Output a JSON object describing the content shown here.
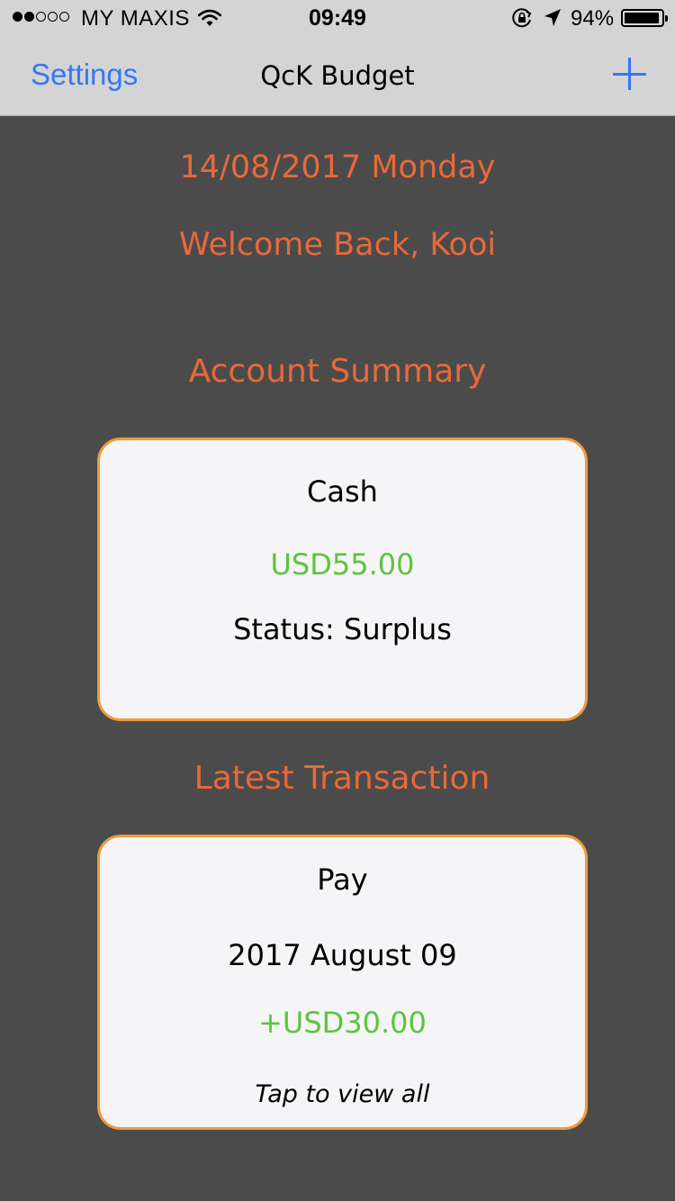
{
  "status_bar": {
    "carrier": "MY MAXIS",
    "time": "09:49",
    "battery_percent_label": "94%",
    "battery_level": 0.94,
    "signal_strength_dots": 2,
    "signal_total_dots": 5
  },
  "nav": {
    "left_button": "Settings",
    "title": "QcK Budget",
    "right_icon": "plus-icon",
    "accent_color": "#3478f6"
  },
  "main": {
    "date": "14/08/2017 Monday",
    "welcome": "Welcome Back, Kooi",
    "account_summary_heading": "Account Summary",
    "latest_transaction_heading": "Latest Transaction",
    "heading_color": "#e8693a"
  },
  "account_card": {
    "account_name": "Cash",
    "balance": "USD55.00",
    "status": "Status: Surplus",
    "balance_color": "#5dc43c",
    "border_color": "#ef9a3a"
  },
  "transaction_card": {
    "description": "Pay",
    "date": "2017 August 09",
    "amount": "+USD30.00",
    "hint": "Tap to view all"
  }
}
